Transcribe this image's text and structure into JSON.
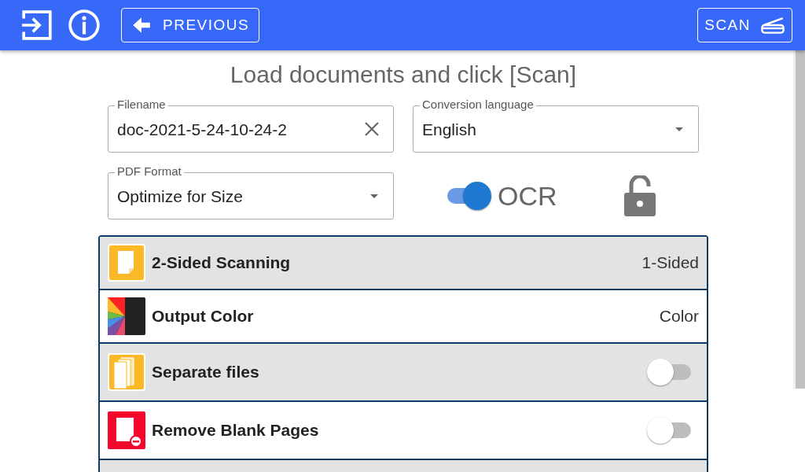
{
  "toolbar": {
    "previous_label": "PREVIOUS",
    "scan_label": "SCAN"
  },
  "heading": "Load documents and click [Scan]",
  "filename": {
    "label": "Filename",
    "value": "doc-2021-5-24-10-24-2"
  },
  "language": {
    "label": "Conversion language",
    "value": "English"
  },
  "pdf_format": {
    "label": "PDF Format",
    "value": "Optimize for Size"
  },
  "ocr": {
    "label": "OCR",
    "on": true
  },
  "options": [
    {
      "kind": "value",
      "label": "2-Sided Scanning",
      "value": "1-Sided"
    },
    {
      "kind": "value",
      "label": "Output Color",
      "value": "Color"
    },
    {
      "kind": "toggle",
      "label": "Separate files",
      "on": false
    },
    {
      "kind": "toggle",
      "label": "Remove Blank Pages",
      "on": false
    }
  ]
}
